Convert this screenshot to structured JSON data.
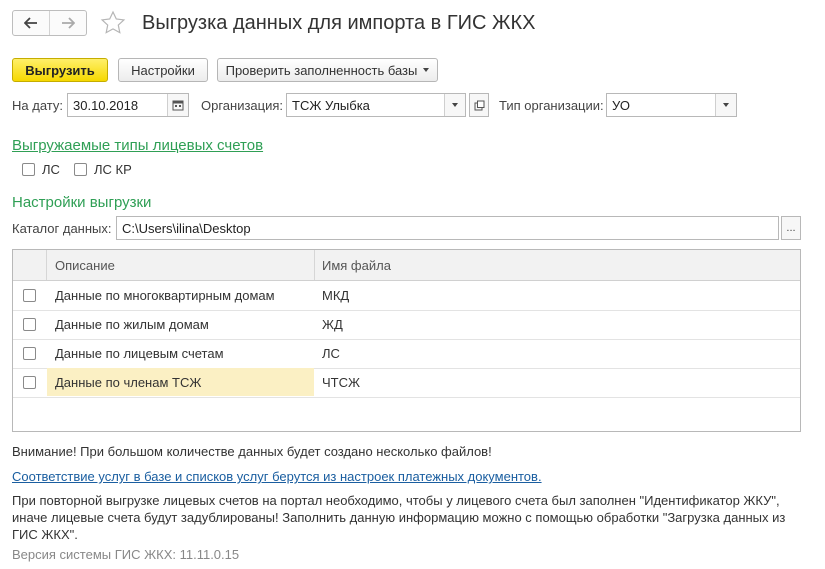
{
  "window": {
    "title": "Выгрузка данных для импорта в ГИС ЖКХ"
  },
  "toolbar": {
    "export_label": "Выгрузить",
    "settings_label": "Настройки",
    "check_label": "Проверить заполненность базы"
  },
  "filters": {
    "date_label": "На дату:",
    "date_value": "30.10.2018",
    "org_label": "Организация:",
    "org_value": "ТСЖ Улыбка",
    "org_type_label": "Тип организации:",
    "org_type_value": "УО"
  },
  "account_types": {
    "title": "Выгружаемые типы лицевых счетов",
    "options": [
      {
        "label": "ЛС",
        "checked": false
      },
      {
        "label": "ЛС КР",
        "checked": false
      }
    ]
  },
  "export_settings": {
    "title": "Настройки выгрузки",
    "catalog_label": "Каталог данных:",
    "catalog_value": "C:\\Users\\ilina\\Desktop",
    "browse_label": "..."
  },
  "table": {
    "columns": [
      "Описание",
      "Имя файла"
    ],
    "rows": [
      {
        "description": "Данные по многоквартирным домам",
        "file": "МКД",
        "checked": false
      },
      {
        "description": "Данные по жилым домам",
        "file": "ЖД",
        "checked": false
      },
      {
        "description": "Данные по лицевым счетам",
        "file": "ЛС",
        "checked": false
      },
      {
        "description": "Данные по членам ТСЖ",
        "file": "ЧТСЖ",
        "checked": false,
        "selected": true
      }
    ]
  },
  "notes": {
    "warning": "Внимание! При большом количестве данных будет создано несколько файлов!",
    "link": "Соответствие услуг в базе и списков услуг берутся из настроек платежных документов.",
    "info_line1": "При повторной выгрузке лицевых счетов на портал необходимо, чтобы у лицевого счета был заполнен \"Идентификатор ЖКУ\",",
    "info_line2": "иначе лицевые счета будут задублированы! Заполнить данную информацию можно с помощью обработки \"Загрузка данных из",
    "info_line3": "ГИС ЖКХ\".",
    "version": "Версия системы ГИС ЖКХ: 11.11.0.15"
  },
  "colors": {
    "accent_yellow": "#f6d800",
    "section_green": "#2f9f55",
    "link_blue": "#1a5ea0",
    "selected_row": "#fbf0c4"
  }
}
